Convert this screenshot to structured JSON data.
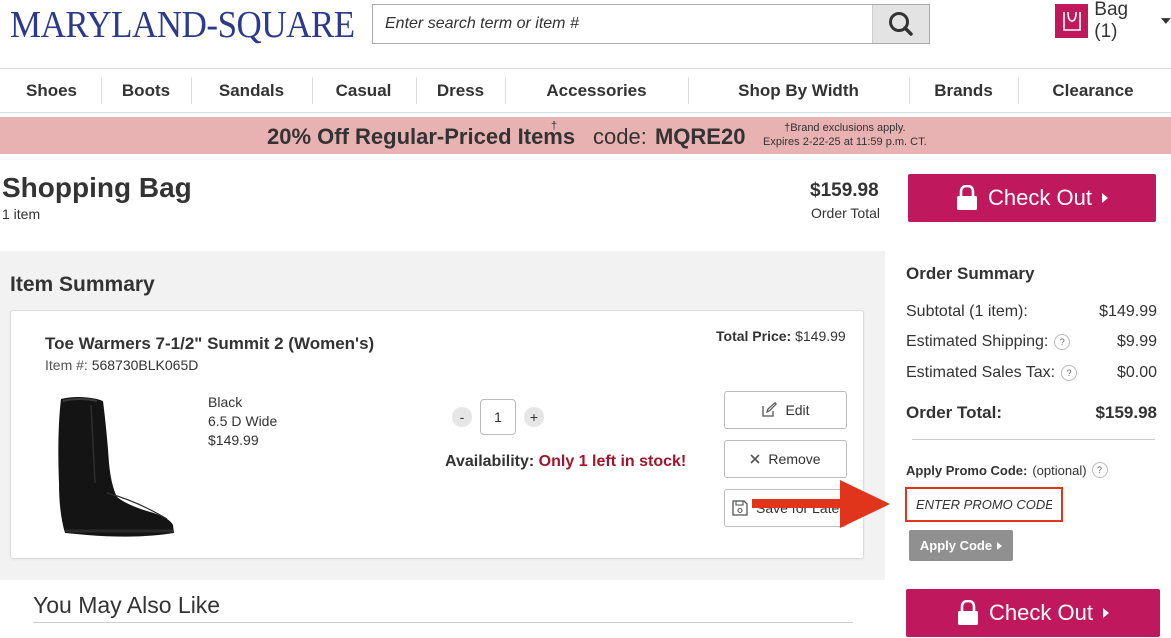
{
  "header": {
    "logo_text": "MARYLAND-SQUARE",
    "search_placeholder": "Enter search term or item #",
    "bag_label": "Bag (1)"
  },
  "nav": [
    "Shoes",
    "Boots",
    "Sandals",
    "Casual",
    "Dress",
    "Accessories",
    "Shop By Width",
    "Brands",
    "Clearance"
  ],
  "promo_banner": {
    "headline": "20% Off Regular-Priced Items",
    "dagger": "†",
    "code_label": "code:",
    "code": "MQRE20",
    "fine_print_1": "†Brand exclusions apply.",
    "fine_print_2": "Expires 2-22-25 at 11:59 p.m. CT."
  },
  "bag": {
    "title": "Shopping Bag",
    "item_count": "1 item",
    "order_total": "$159.98",
    "order_total_label": "Order Total",
    "checkout_label": "Check Out"
  },
  "item_summary": {
    "title": "Item Summary",
    "item": {
      "name": "Toe Warmers 7-1/2\" Summit 2 (Women's)",
      "item_no_label": "Item #:",
      "item_no": "568730BLK065D",
      "total_price_label": "Total Price:",
      "total_price": "$149.99",
      "color": "Black",
      "size": "6.5 D Wide",
      "price": "$149.99",
      "quantity": "1",
      "qty_minus": "-",
      "qty_plus": "+",
      "availability_label": "Availability:",
      "availability_value": "Only 1 left in stock!"
    },
    "actions": {
      "edit": "Edit",
      "remove": "Remove",
      "save_for_later": "Save for Later"
    }
  },
  "order_summary": {
    "title": "Order Summary",
    "subtotal_label": "Subtotal (1 item):",
    "subtotal": "$149.99",
    "shipping_label": "Estimated Shipping:",
    "shipping": "$9.99",
    "tax_label": "Estimated Sales Tax:",
    "tax": "$0.00",
    "total_label": "Order Total:",
    "total": "$159.98",
    "promo_label": "Apply Promo Code:",
    "promo_optional": "(optional)",
    "promo_placeholder": "ENTER PROMO CODE",
    "apply_button": "Apply Code",
    "checkout_label": "Check Out"
  },
  "recommendations": {
    "title": "You May Also Like"
  },
  "colors": {
    "brand_magenta": "#c0185c",
    "banner_pink": "#e8b2b2",
    "stock_red": "#a3142a",
    "annotation_arrow": "#e0351b",
    "logo_blue": "#2d3a8c"
  }
}
